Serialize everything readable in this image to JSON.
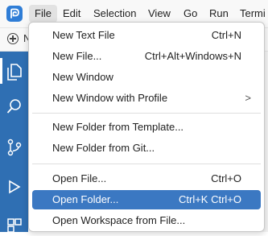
{
  "menubar": {
    "items": [
      "File",
      "Edit",
      "Selection",
      "View",
      "Go",
      "Run",
      "Termi"
    ]
  },
  "subbar": {
    "text": "N"
  },
  "activitybar": {
    "icons": [
      "explorer-icon",
      "search-icon",
      "source-control-icon",
      "run-debug-icon",
      "extensions-icon"
    ]
  },
  "file_menu": {
    "items": [
      {
        "label": "New Text File",
        "shortcut": "Ctrl+N"
      },
      {
        "label": "New File...",
        "shortcut": "Ctrl+Alt+Windows+N"
      },
      {
        "label": "New Window",
        "shortcut": ""
      },
      {
        "label": "New Window with Profile",
        "shortcut": ""
      },
      {
        "label": "New Folder from Template...",
        "shortcut": ""
      },
      {
        "label": "New Folder from Git...",
        "shortcut": ""
      },
      {
        "label": "Open File...",
        "shortcut": "Ctrl+O"
      },
      {
        "label": "Open Folder...",
        "shortcut": "Ctrl+K Ctrl+O"
      },
      {
        "label": "Open Workspace from File...",
        "shortcut": ""
      }
    ],
    "submenu_chevron": ">"
  },
  "colors": {
    "accent": "#3b78c2",
    "activitybar": "#2f6fb3",
    "logo": "#2f7dd6"
  }
}
